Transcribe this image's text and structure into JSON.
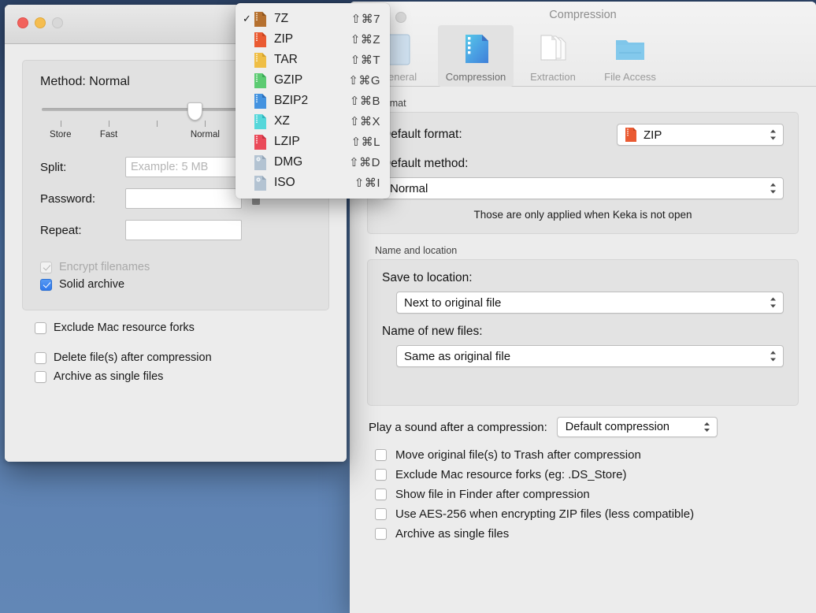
{
  "desktop": {
    "background_top": "#2d4468",
    "background_bottom": "#6287b6"
  },
  "left_window": {
    "method": {
      "title": "Method: Normal",
      "slider_labels": [
        "Store",
        "Fast",
        "Normal"
      ],
      "slider_value": "Normal"
    },
    "split": {
      "label": "Split:",
      "value": "",
      "placeholder": "Example: 5 MB"
    },
    "password": {
      "label": "Password:",
      "value": ""
    },
    "repeat": {
      "label": "Repeat:",
      "value": ""
    },
    "lock_icon": "unlocked-padlock-icon",
    "inner_checkboxes": [
      {
        "label": "Encrypt filenames",
        "checked": true,
        "disabled": true
      },
      {
        "label": "Solid archive",
        "checked": true,
        "disabled": false
      }
    ],
    "outer_checkboxes": [
      {
        "label": "Exclude Mac resource forks",
        "checked": false
      },
      {
        "label": "Delete file(s) after compression",
        "checked": false
      },
      {
        "label": "Archive as single files",
        "checked": false
      }
    ]
  },
  "format_menu": {
    "items": [
      {
        "name": "7Z",
        "shortcut": "⇧⌘7",
        "checked": true,
        "icon": "archive-7z-icon",
        "color": "#a5632b",
        "color2": "#c4813f"
      },
      {
        "name": "ZIP",
        "shortcut": "⇧⌘Z",
        "checked": false,
        "icon": "archive-zip-icon",
        "color": "#e1502a",
        "color2": "#f07040"
      },
      {
        "name": "TAR",
        "shortcut": "⇧⌘T",
        "checked": false,
        "icon": "archive-tar-icon",
        "color": "#e8b432",
        "color2": "#f6cf5c"
      },
      {
        "name": "GZIP",
        "shortcut": "⇧⌘G",
        "checked": false,
        "icon": "archive-gzip-icon",
        "color": "#46c362",
        "color2": "#80dd8c"
      },
      {
        "name": "BZIP2",
        "shortcut": "⇧⌘B",
        "checked": false,
        "icon": "archive-bzip2-icon",
        "color": "#2f7fd8",
        "color2": "#66aae8"
      },
      {
        "name": "XZ",
        "shortcut": "⇧⌘X",
        "checked": false,
        "icon": "archive-xz-icon",
        "color": "#2fc4cf",
        "color2": "#78e2e2"
      },
      {
        "name": "LZIP",
        "shortcut": "⇧⌘L",
        "checked": false,
        "icon": "archive-lzip-icon",
        "color": "#e2414f",
        "color2": "#f27080"
      },
      {
        "name": "DMG",
        "shortcut": "⇧⌘D",
        "checked": false,
        "icon": "disk-dmg-icon",
        "color": "#8fa3b8",
        "color2": "#c2d0dc"
      },
      {
        "name": "ISO",
        "shortcut": "⇧⌘I",
        "checked": false,
        "icon": "disk-iso-icon",
        "color": "#8fa3b8",
        "color2": "#c2d0dc"
      }
    ]
  },
  "right_window": {
    "title": "Compression",
    "toolbar": [
      {
        "label": "General",
        "icon": "general-gear-icon",
        "selected": false
      },
      {
        "label": "Compression",
        "icon": "compression-icon",
        "selected": true
      },
      {
        "label": "Extraction",
        "icon": "extraction-icon",
        "selected": false
      },
      {
        "label": "File Access",
        "icon": "folder-icon",
        "selected": false
      }
    ],
    "format_group": {
      "title": "Format",
      "default_format_label": "Default format:",
      "default_format_value": "ZIP",
      "default_method_label": "Default method:",
      "default_method_value": "Normal",
      "hint": "Those are only applied when Keka is not open"
    },
    "name_group": {
      "title": "Name and location",
      "save_label": "Save to location:",
      "save_value": "Next to original file",
      "name_label": "Name of new files:",
      "name_value": "Same as original file"
    },
    "sound": {
      "label": "Play a sound after a compression:",
      "value": "Default compression"
    },
    "checkboxes": [
      {
        "label": "Move original file(s) to Trash after compression",
        "checked": false
      },
      {
        "label": "Exclude Mac resource forks (eg: .DS_Store)",
        "checked": false
      },
      {
        "label": "Show file in Finder after compression",
        "checked": false
      },
      {
        "label": "Use AES-256 when encrypting ZIP files (less compatible)",
        "checked": false
      },
      {
        "label": "Archive as single files",
        "checked": false
      }
    ]
  }
}
